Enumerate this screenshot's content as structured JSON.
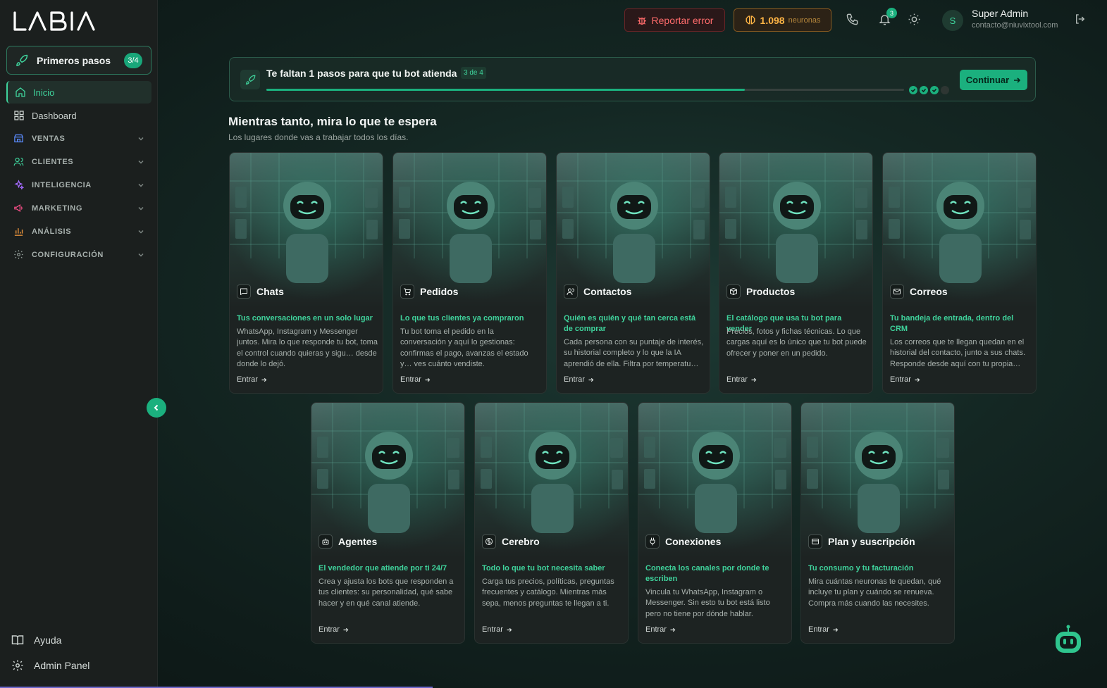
{
  "app": {
    "brand": "LABIA",
    "accent": "#1bb07e",
    "accent_text": "#3fd39c"
  },
  "sidebar": {
    "primeros_pasos": {
      "label": "Primeros pasos",
      "count": "3/4",
      "icon": "rocket-icon"
    },
    "items": [
      {
        "label": "Inicio",
        "icon": "home-icon",
        "active": true
      },
      {
        "label": "Dashboard",
        "icon": "grid-icon"
      },
      {
        "label": "VENTAS",
        "icon": "store-icon",
        "section": true
      },
      {
        "label": "CLIENTES",
        "icon": "users-icon",
        "section": true
      },
      {
        "label": "INTELIGENCIA",
        "icon": "sparkles-icon",
        "section": true
      },
      {
        "label": "MARKETING",
        "icon": "megaphone-icon",
        "section": true
      },
      {
        "label": "ANÁLISIS",
        "icon": "bar-chart-icon",
        "section": true
      },
      {
        "label": "CONFIGURACIÓN",
        "icon": "gear-icon",
        "section": true
      }
    ],
    "bottom": [
      {
        "label": "Ayuda",
        "icon": "book-icon"
      },
      {
        "label": "Admin Panel",
        "icon": "gear-icon"
      }
    ]
  },
  "topbar": {
    "report_label": "Reportar error",
    "neurons_value": "1.098",
    "neurons_unit": "neuronas",
    "notifications_count": "3",
    "user_initial": "S",
    "user_name": "Super Admin",
    "user_email": "contacto@niuvixtool.com"
  },
  "progress": {
    "title": "Te faltan 1 pasos para que tu bot atienda",
    "step": "3 de 4",
    "fraction": 0.75,
    "completed_steps": 3,
    "total_steps": 4,
    "continue_label": "Continuar"
  },
  "section": {
    "title": "Mientras tanto, mira lo que te espera",
    "subtitle": "Los lugares donde vas a trabajar todos los días."
  },
  "cards": [
    {
      "title": "Chats",
      "icon": "chat-icon",
      "tag": "Tus conversaciones en un solo lugar",
      "desc": "WhatsApp, Instagram y Messenger juntos. Mira lo que responde tu bot, toma el control cuando quieras y sigu… desde donde lo dejó.",
      "enter": "Entrar"
    },
    {
      "title": "Pedidos",
      "icon": "cart-icon",
      "tag": "Lo que tus clientes ya compraron",
      "desc": "Tu bot toma el pedido en la conversación y aquí lo gestionas: confirmas el pago, avanzas el estado y… ves cuánto vendiste.",
      "enter": "Entrar"
    },
    {
      "title": "Contactos",
      "icon": "contacts-icon",
      "tag": "Quién es quién y qué tan cerca está de comprar",
      "desc": "Cada persona con su puntaje de interés, su historial completo y lo que la IA aprendió de ella. Filtra por temperatu…",
      "enter": "Entrar"
    },
    {
      "title": "Productos",
      "icon": "box-icon",
      "tag": "El catálogo que usa tu bot para vender",
      "desc": "Precios, fotos y fichas técnicas. Lo que cargas aquí es lo único que tu bot puede ofrecer y poner en un pedido.",
      "enter": "Entrar"
    },
    {
      "title": "Correos",
      "icon": "mail-icon",
      "tag": "Tu bandeja de entrada, dentro del CRM",
      "desc": "Los correos que te llegan quedan en el historial del contacto, junto a sus chats. Responde desde aquí con tu propia…",
      "enter": "Entrar"
    },
    {
      "title": "Agentes",
      "icon": "bot-icon",
      "tag": "El vendedor que atiende por ti 24/7",
      "desc": "Crea y ajusta los bots que responden a tus clientes: su personalidad, qué sabe hacer y en qué canal atiende.",
      "enter": "Entrar"
    },
    {
      "title": "Cerebro",
      "icon": "brain-icon",
      "tag": "Todo lo que tu bot necesita saber",
      "desc": "Carga tus precios, políticas, preguntas frecuentes y catálogo. Mientras más sepa, menos preguntas te llegan a ti.",
      "enter": "Entrar"
    },
    {
      "title": "Conexiones",
      "icon": "plug-icon",
      "tag": "Conecta los canales por donde te escriben",
      "desc": "Vincula tu WhatsApp, Instagram o Messenger. Sin esto tu bot está listo pero no tiene por dónde hablar.",
      "enter": "Entrar"
    },
    {
      "title": "Plan y suscripción",
      "icon": "card-icon",
      "tag": "Tu consumo y tu facturación",
      "desc": "Mira cuántas neuronas te quedan, qué incluye tu plan y cuándo se renueva. Compra más cuando las necesites.",
      "enter": "Entrar"
    }
  ]
}
